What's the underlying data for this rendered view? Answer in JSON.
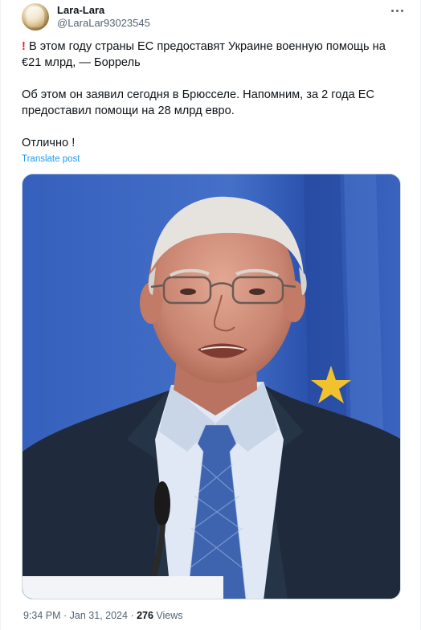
{
  "author": {
    "display_name": "Lara-Lara",
    "handle": "@LaraLar93023545"
  },
  "tweet": {
    "alert_icon": "!",
    "para1": "В этом году страны ЕС предоставят Украине военную помощь на €21 млрд, — Боррель",
    "para2": "Об этом он заявил сегодня в Брюсселе. Напомним, за 2 года ЕС предоставил помощи на 28 млрд евро.",
    "para3": "Отлично !",
    "translate_label": "Translate post"
  },
  "meta": {
    "time": "9:34 PM",
    "separator1": " · ",
    "date": "Jan 31, 2024",
    "separator2": " · ",
    "views_count": "276",
    "views_label": " Views"
  },
  "colors": {
    "link": "#1d9bf0",
    "alert": "#e0243a",
    "secondary": "#536471",
    "flag_blue": "#2f58b8",
    "flag_star": "#f2c12e"
  }
}
